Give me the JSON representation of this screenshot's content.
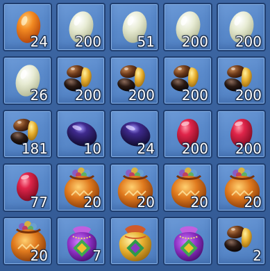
{
  "inventory": {
    "slots": [
      {
        "item": "orange-egg-icon",
        "count": "24"
      },
      {
        "item": "pale-egg-icon",
        "count": "200"
      },
      {
        "item": "pale-egg-icon",
        "count": "51"
      },
      {
        "item": "pale-egg-icon",
        "count": "200"
      },
      {
        "item": "pale-egg-icon",
        "count": "200"
      },
      {
        "item": "pale-egg-icon",
        "count": "26"
      },
      {
        "item": "bean-pile-icon",
        "count": "200"
      },
      {
        "item": "bean-pile-icon",
        "count": "200"
      },
      {
        "item": "bean-pile-icon",
        "count": "200"
      },
      {
        "item": "bean-pile-icon",
        "count": "200"
      },
      {
        "item": "bean-pile-icon",
        "count": "181"
      },
      {
        "item": "purple-gem-icon",
        "count": "10"
      },
      {
        "item": "purple-gem-icon",
        "count": "24"
      },
      {
        "item": "red-gem-icon",
        "count": "200"
      },
      {
        "item": "red-gem-icon",
        "count": "200"
      },
      {
        "item": "red-gem-icon",
        "count": "77"
      },
      {
        "item": "orange-sack-icon",
        "count": "20"
      },
      {
        "item": "orange-sack-icon",
        "count": "20"
      },
      {
        "item": "orange-sack-icon",
        "count": "20"
      },
      {
        "item": "orange-sack-icon",
        "count": "20"
      },
      {
        "item": "orange-sack-icon",
        "count": "20"
      },
      {
        "item": "purple-pouch-icon",
        "count": "7"
      },
      {
        "item": "gold-pouch-icon",
        "count": ""
      },
      {
        "item": "purple-pouch-icon",
        "count": ""
      },
      {
        "item": "bean-pile-icon",
        "count": "2"
      }
    ]
  },
  "colors": {
    "slot_bg": "#5a8acb",
    "slot_border": "#1f3d6e",
    "count_text": "#ffffff"
  }
}
